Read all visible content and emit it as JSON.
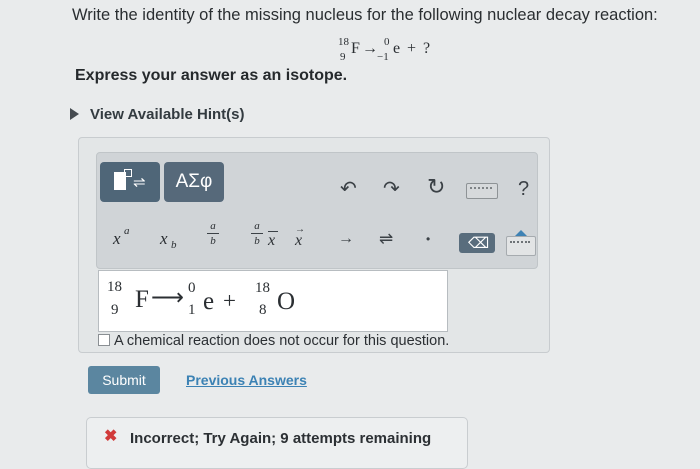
{
  "question": {
    "text": "Write the identity of the missing nucleus for the following nuclear decay reaction:",
    "reaction": {
      "reactant_mass": "18",
      "reactant_atomic": "9",
      "reactant_symbol": "F",
      "arrow": "→",
      "product_mass": "0",
      "product_charge": "−1",
      "product_symbol": "e",
      "plus": "+",
      "unknown": "?"
    },
    "instruction": "Express your answer as an isotope."
  },
  "hints": {
    "label": "View Available Hint(s)"
  },
  "toolbar": {
    "greek_label": "ΑΣφ",
    "superscript_x": "x",
    "superscript_a": "a",
    "subscript_x": "x",
    "subscript_b": "b",
    "frac_num": "a",
    "frac_den": "b",
    "frac2_num": "a",
    "frac2_den": "b",
    "vector_x": "x",
    "overline_x": "x",
    "arrow_right": "→",
    "equilibrium": "⇌",
    "dot": "•",
    "help": "?"
  },
  "answer": {
    "reactant_mass": "18",
    "reactant_atomic": "9",
    "reactant_symbol": "F",
    "arrow": "⟶",
    "product_mass": "0",
    "product_charge": "1",
    "product_symbol": "e",
    "plus": "+",
    "unknown_mass": "18",
    "unknown_atomic": "8",
    "unknown_symbol": "O"
  },
  "no_reaction": {
    "label": "A chemical reaction does not occur for this question."
  },
  "actions": {
    "submit": "Submit",
    "previous": "Previous Answers"
  },
  "feedback": {
    "icon": "✖",
    "text": "Incorrect; Try Again; 9 attempts remaining"
  },
  "colors": {
    "primary_button": "#5b86a0",
    "error": "#d13a3a",
    "link": "#3c82b4"
  }
}
